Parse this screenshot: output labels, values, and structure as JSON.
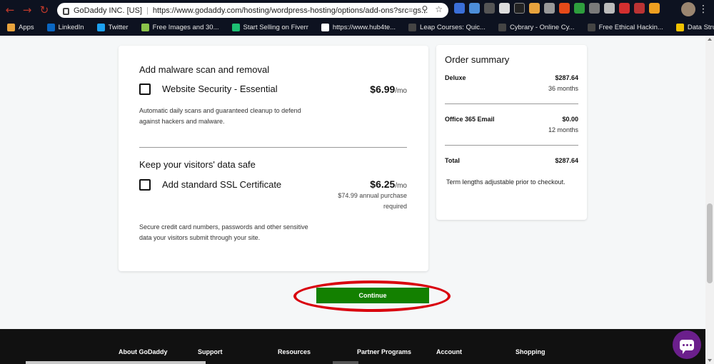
{
  "browser": {
    "site_name": "GoDaddy INC. [US]",
    "url": "https://www.godaddy.com/hosting/wordpress-hosting/options/add-ons?src=gs..."
  },
  "bookmarks": [
    {
      "label": "Apps",
      "icon": "apps-grid-icon",
      "color": "#e8a33d"
    },
    {
      "label": "LinkedIn",
      "icon": "linkedin-icon",
      "color": "#0a66c2"
    },
    {
      "label": "Twitter",
      "icon": "twitter-icon",
      "color": "#1da1f2"
    },
    {
      "label": "Free Images and 30...",
      "icon": "image-icon",
      "color": "#8bc34a"
    },
    {
      "label": "Start Selling on Fiverr",
      "icon": "fiverr-icon",
      "color": "#1dbf73"
    },
    {
      "label": "https://www.hub4te...",
      "icon": "hub-icon",
      "color": "#ffffff"
    },
    {
      "label": "Leap Courses: Quic...",
      "icon": "leap-icon",
      "color": "#444444"
    },
    {
      "label": "Cybrary - Online Cy...",
      "icon": "cybrary-icon",
      "color": "#444444"
    },
    {
      "label": "Free Ethical Hackin...",
      "icon": "hacking-icon",
      "color": "#444444"
    },
    {
      "label": "Data Structure Visu...",
      "icon": "usf-icon",
      "color": "#f2c200"
    }
  ],
  "addons": {
    "malware": {
      "title": "Add malware scan and removal",
      "option_label": "Website Security - Essential",
      "price": "$6.99",
      "per": "/mo",
      "description": "Automatic daily scans and guaranteed cleanup to defend against hackers and malware."
    },
    "ssl": {
      "title": "Keep your visitors' data safe",
      "option_label": "Add standard SSL Certificate",
      "price": "$6.25",
      "per": "/mo",
      "price_note": "$74.99 annual purchase required",
      "description": "Secure credit card numbers, passwords and other sensitive data your visitors submit through your site."
    }
  },
  "summary": {
    "title": "Order summary",
    "items": [
      {
        "name": "Deluxe",
        "amount": "$287.64",
        "term": "36 months"
      },
      {
        "name": "Office 365 Email",
        "amount": "$0.00",
        "term": "12 months"
      }
    ],
    "total_label": "Total",
    "total_amount": "$287.64",
    "note": "Term lengths adjustable prior to checkout."
  },
  "continue_label": "Continue",
  "footer": {
    "links": [
      "About GoDaddy",
      "Support",
      "Resources",
      "Partner Programs",
      "Account",
      "Shopping"
    ]
  },
  "colors": {
    "continue_green": "#138000",
    "highlight_red": "#d9000d",
    "chat_purple": "#6b1f8c"
  }
}
